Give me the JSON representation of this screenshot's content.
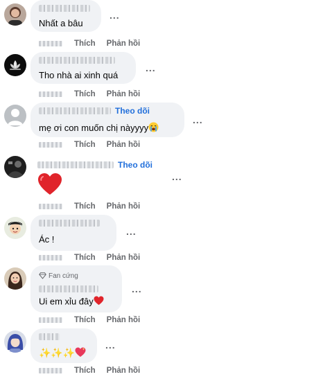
{
  "actions": {
    "like_label": "Thích",
    "reply_label": "Phản hồi",
    "more_label": "..."
  },
  "comments": [
    {
      "text": "Nhất a bâu",
      "avatar_icon": "person-avatar-icon"
    },
    {
      "text": "Tho nhà ai xinh quá",
      "avatar_icon": "lotus-avatar-icon"
    },
    {
      "text": "mẹ ơi con muốn chị nàyyyy",
      "emoji": "loudly-crying-face-emoji",
      "follow_label": "Theo dõi",
      "avatar_icon": "default-user-avatar-icon"
    },
    {
      "text": "",
      "sticker": "red-heart-sticker",
      "follow_label": "Theo dõi",
      "avatar_icon": "dark-photo-avatar-icon"
    },
    {
      "text": "Ác !",
      "avatar_icon": "cartoon-avatar-icon"
    },
    {
      "text": "Ui em xỉu đây",
      "emoji": "red-heart-emoji",
      "badge_label": "Fan cứng",
      "badge_icon": "diamond-icon",
      "avatar_icon": "woman-avatar-icon"
    },
    {
      "text": "✨✨✨",
      "emoji": "sparkling-heart-emoji",
      "avatar_icon": "blue-hair-avatar-icon"
    }
  ],
  "colors": {
    "bubble": "#f0f2f5",
    "muted_text": "#65676b",
    "link_blue": "#216fdb",
    "heart_red": "#e0242b"
  }
}
